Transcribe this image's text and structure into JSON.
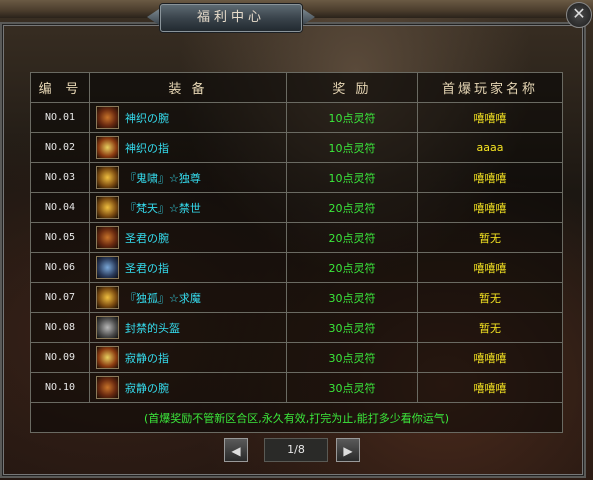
{
  "window": {
    "title": "福利中心",
    "close_glyph": "✕"
  },
  "table": {
    "headers": {
      "no": "编 号",
      "equip": "装 备",
      "reward": "奖 励",
      "player": "首爆玩家名称"
    },
    "rows": [
      {
        "no": "NO.01",
        "equip": "神织の腕",
        "icon": "bracer-icon",
        "reward": "10点灵符",
        "player": "嘻嘻嘻"
      },
      {
        "no": "NO.02",
        "equip": "神织の指",
        "icon": "ring-icon",
        "reward": "10点灵符",
        "player": "aaaa"
      },
      {
        "no": "NO.03",
        "equip": "『鬼啸』☆独尊",
        "icon": "medal-icon",
        "reward": "10点灵符",
        "player": "嘻嘻嘻"
      },
      {
        "no": "NO.04",
        "equip": "『梵天』☆禁世",
        "icon": "medal-icon",
        "reward": "20点灵符",
        "player": "嘻嘻嘻"
      },
      {
        "no": "NO.05",
        "equip": "圣君の腕",
        "icon": "bracer-icon",
        "reward": "20点灵符",
        "player": "暂无"
      },
      {
        "no": "NO.06",
        "equip": "圣君の指",
        "icon": "ring-icon",
        "reward": "20点灵符",
        "player": "嘻嘻嘻"
      },
      {
        "no": "NO.07",
        "equip": "『独孤』☆求魔",
        "icon": "medal-icon",
        "reward": "30点灵符",
        "player": "暂无"
      },
      {
        "no": "NO.08",
        "equip": "封禁的头盔",
        "icon": "helmet-icon",
        "reward": "30点灵符",
        "player": "暂无"
      },
      {
        "no": "NO.09",
        "equip": "寂静の指",
        "icon": "ring-icon",
        "reward": "30点灵符",
        "player": "嘻嘻嘻"
      },
      {
        "no": "NO.10",
        "equip": "寂静の腕",
        "icon": "bracer-icon",
        "reward": "30点灵符",
        "player": "嘻嘻嘻"
      }
    ],
    "footer_note": "(首爆奖励不管新区合区,永久有效,打完为止,能打多少看你运气)"
  },
  "pager": {
    "prev_glyph": "◀",
    "next_glyph": "▶",
    "page_info": "1/8"
  },
  "colors": {
    "equip_name": "#35dcee",
    "reward": "#3be83b",
    "player": "#f5e422",
    "header": "#e6d6b4"
  }
}
